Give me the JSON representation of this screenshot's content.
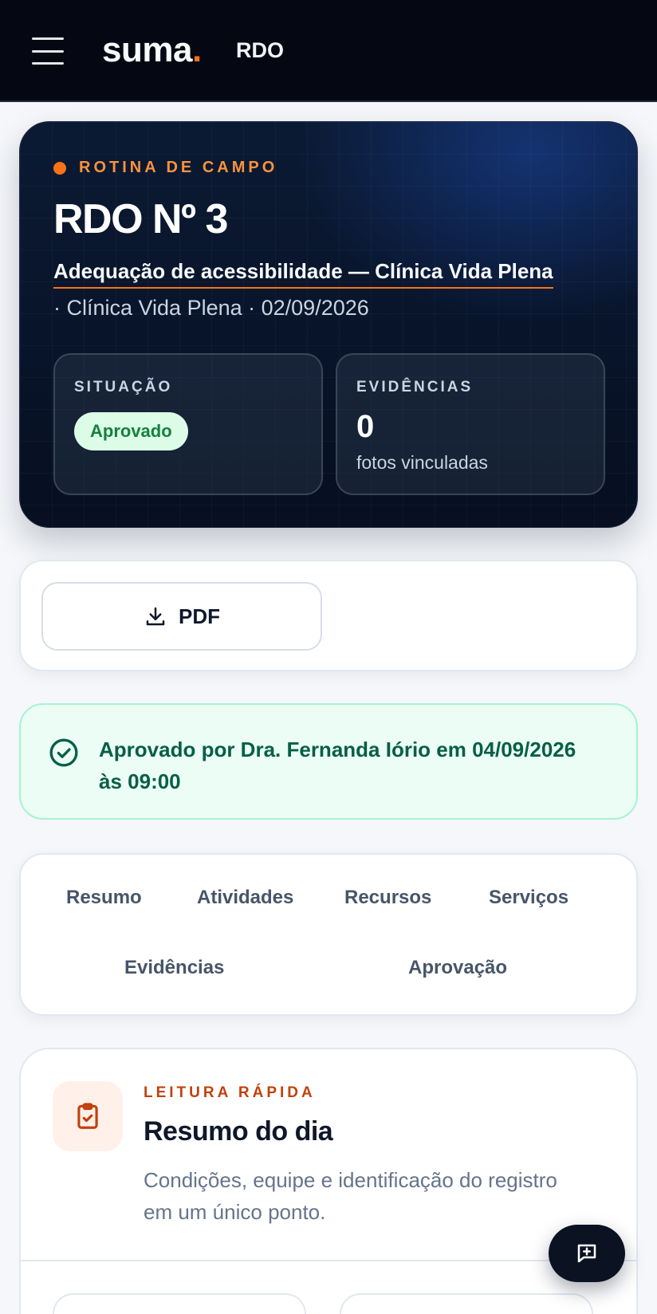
{
  "header": {
    "brand": "suma",
    "brand_dot": ".",
    "section": "RDO"
  },
  "hero": {
    "eyebrow": "ROTINA DE CAMPO",
    "title": "RDO Nº 3",
    "project": "Adequação de acessibilidade — Clínica Vida Plena",
    "meta": "· Clínica Vida Plena · 02/09/2026",
    "status": {
      "label": "SITUAÇÃO",
      "value": "Aprovado"
    },
    "evidence": {
      "label": "EVIDÊNCIAS",
      "count": "0",
      "sub": "fotos vinculadas"
    }
  },
  "actions": {
    "pdf_label": "PDF"
  },
  "approval": {
    "text": "Aprovado por Dra. Fernanda Iório em 04/09/2026 às 09:00"
  },
  "tabs": [
    {
      "label": "Resumo"
    },
    {
      "label": "Atividades"
    },
    {
      "label": "Recursos"
    },
    {
      "label": "Serviços"
    },
    {
      "label": "Evidências"
    },
    {
      "label": "Aprovação"
    }
  ],
  "summary": {
    "eyebrow": "LEITURA RÁPIDA",
    "title": "Resumo do dia",
    "description": "Condições, equipe e identificação do registro em um único ponto."
  },
  "colors": {
    "accent": "#f97316",
    "approved_bg": "#dcfce7",
    "approved_text": "#15803d"
  },
  "icons": {
    "menu": "menu-icon",
    "download": "download-icon",
    "approved": "check-circle-icon",
    "summary": "clipboard-check-icon",
    "fab": "message-plus-icon"
  }
}
